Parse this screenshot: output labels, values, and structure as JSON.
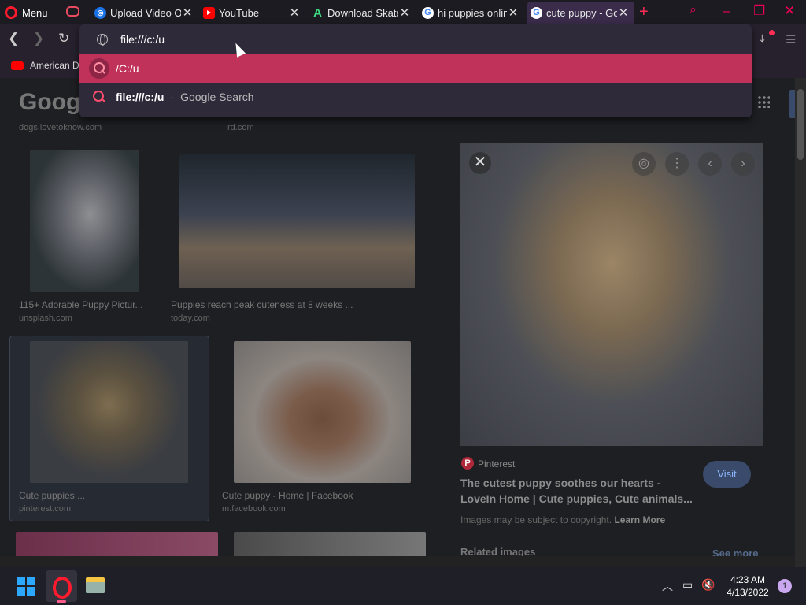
{
  "browser": {
    "menu_label": "Menu",
    "tabs": [
      {
        "title": "Upload Video O",
        "icon": "lens-icon"
      },
      {
        "title": "YouTube",
        "icon": "youtube-icon"
      },
      {
        "title": "Download Skate",
        "icon": "apkpure-icon"
      },
      {
        "title": "hi puppies onlin",
        "icon": "google-icon"
      },
      {
        "title": "cute puppy - Go",
        "icon": "google-icon",
        "active": true
      }
    ],
    "new_tab_symbol": "+",
    "close_symbol": "✕"
  },
  "address_bar": {
    "value": "file:///c:/u",
    "suggestions": [
      {
        "text": "/C:/u",
        "selected": true
      },
      {
        "bold": "file:///c:/u",
        "separator": "-",
        "source": "Google Search"
      }
    ]
  },
  "bookmarks": [
    {
      "label": "American Da",
      "icon": "youtube-icon"
    }
  ],
  "page": {
    "logo": "Googl",
    "top_sources": [
      "dogs.lovetoknow.com",
      "rd.com"
    ],
    "results": [
      {
        "title": "115+ Adorable Puppy Pictur...",
        "source": "unsplash.com"
      },
      {
        "title": "Puppies reach peak cuteness at 8 weeks ...",
        "source": "today.com"
      },
      {
        "title": "Cute puppies ...",
        "source": "pinterest.com"
      },
      {
        "title": "Cute puppy - Home | Facebook",
        "source": "m.facebook.com"
      }
    ],
    "preview": {
      "source": "Pinterest",
      "title": "The cutest puppy soothes our hearts - LoveIn Home | Cute puppies, Cute animals...",
      "visit_label": "Visit",
      "copyright_text": "Images may be subject to copyright.",
      "learn_more": "Learn More",
      "related_label": "Related images",
      "see_more": "See more"
    }
  },
  "taskbar": {
    "time": "4:23 AM",
    "date": "4/13/2022",
    "notification_count": "1"
  },
  "colors": {
    "accent": "#c0325a",
    "opera_red": "#ff1b2d",
    "tab_active": "#3a2c4a"
  }
}
